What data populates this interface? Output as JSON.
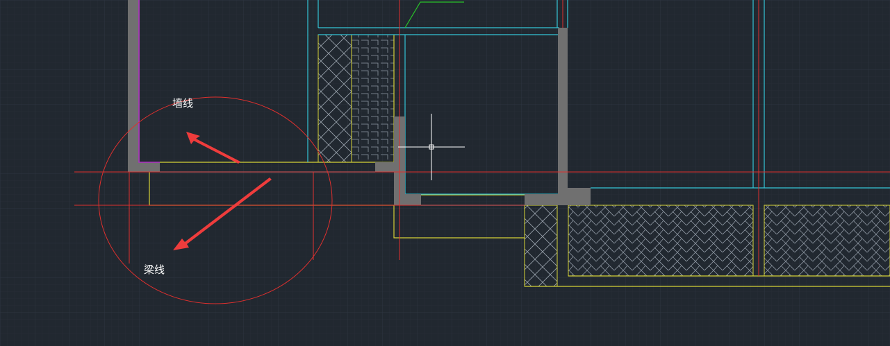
{
  "annotations": {
    "wall_line": "墙线",
    "beam_line": "梁线"
  },
  "colors": {
    "background": "#212830",
    "grid": "#2a323c",
    "wall_fill": "#707070",
    "axis_red": "#e0302e",
    "cyan": "#33c5d6",
    "yellow": "#d7d337",
    "magenta": "#b02fc4",
    "green": "#29c529",
    "arrow": "#ee3c3c",
    "hatch": "#9aa3ad",
    "crosshair": "#ffffff"
  },
  "icons": {
    "cursor": "crosshair-cursor-icon",
    "arrow": "arrow-icon"
  }
}
